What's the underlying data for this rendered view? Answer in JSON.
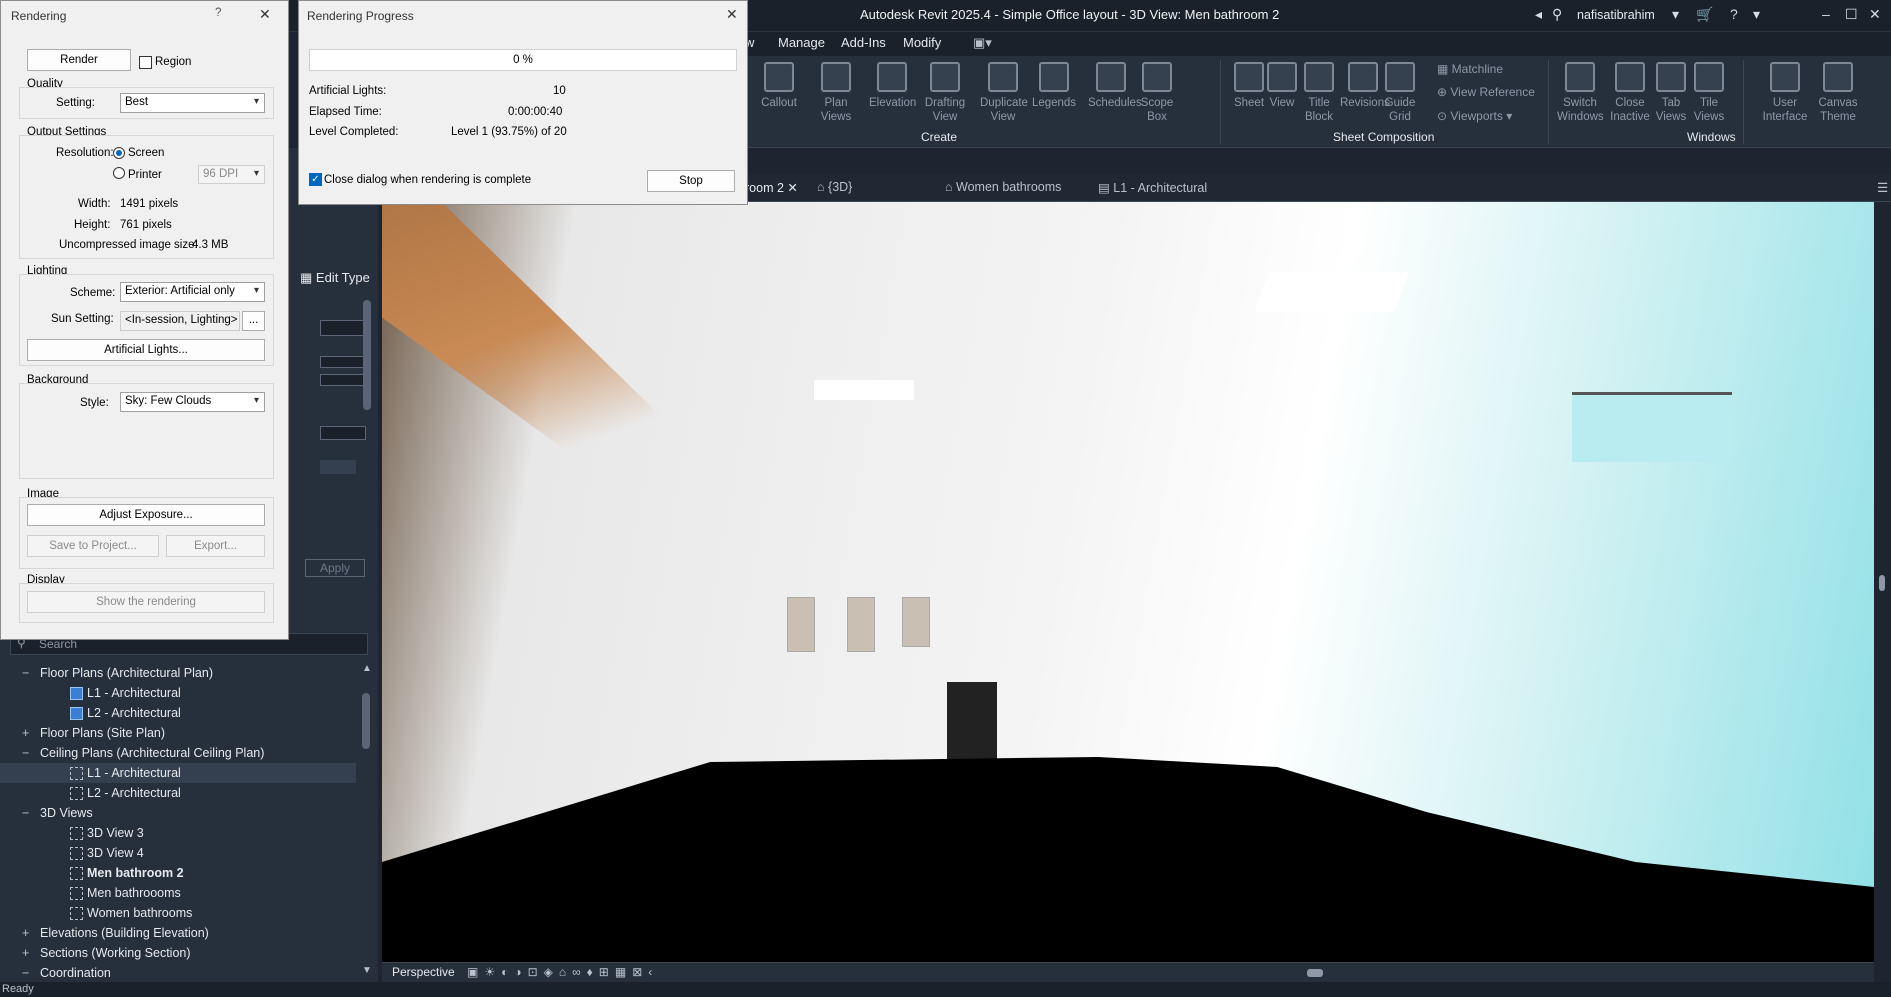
{
  "app": {
    "title": "Autodesk Revit 2025.4 - Simple Office layout - 3D View: Men bathroom 2",
    "user": "nafisatibrahim"
  },
  "ribbon": {
    "tabs": [
      "w",
      "Manage",
      "Add-Ins",
      "Modify"
    ],
    "buttons": [
      {
        "label": "Callout",
        "icon": "callout-icon"
      },
      {
        "label": "Plan Views",
        "icon": "plan-views-icon"
      },
      {
        "label": "Elevation",
        "icon": "elevation-icon"
      },
      {
        "label": "Drafting View",
        "icon": "drafting-view-icon"
      },
      {
        "label": "Duplicate View",
        "icon": "duplicate-view-icon"
      },
      {
        "label": "Legends",
        "icon": "legends-icon"
      },
      {
        "label": "Schedules",
        "icon": "schedules-icon"
      },
      {
        "label": "Scope Box",
        "icon": "scope-box-icon"
      },
      {
        "label": "Sheet",
        "icon": "sheet-icon"
      },
      {
        "label": "View",
        "icon": "view-icon"
      },
      {
        "label": "Title Block",
        "icon": "title-block-icon"
      },
      {
        "label": "Revisions",
        "icon": "revisions-icon"
      },
      {
        "label": "Guide Grid",
        "icon": "guide-grid-icon"
      },
      {
        "label": "Switch Windows",
        "icon": "switch-windows-icon"
      },
      {
        "label": "Close Inactive",
        "icon": "close-inactive-icon"
      },
      {
        "label": "Tab Views",
        "icon": "tab-views-icon"
      },
      {
        "label": "Tile Views",
        "icon": "tile-views-icon"
      },
      {
        "label": "User Interface",
        "icon": "user-interface-icon"
      },
      {
        "label": "Canvas Theme",
        "icon": "canvas-theme-icon"
      }
    ],
    "small": {
      "matchline": "Matchline",
      "view_reference": "View  Reference",
      "viewports": "Viewports"
    },
    "groups": {
      "create": "Create",
      "sheet_composition": "Sheet Composition",
      "windows": "Windows"
    }
  },
  "view_tabs": [
    "room 2",
    "{3D}",
    "Women bathrooms",
    "L1 - Architectural"
  ],
  "properties": {
    "edit_type": "Edit Type",
    "apply": "Apply"
  },
  "browser": {
    "search_placeholder": "Search",
    "items": [
      {
        "label": "Floor Plans (Architectural Plan)",
        "level": 0,
        "pm": "−"
      },
      {
        "label": "L1 - Architectural",
        "level": 1,
        "icon": "floor-plan-icon"
      },
      {
        "label": "L2 - Architectural",
        "level": 1,
        "icon": "floor-plan-icon"
      },
      {
        "label": "Floor Plans (Site Plan)",
        "level": 0,
        "pm": "+"
      },
      {
        "label": "Ceiling Plans (Architectural Ceiling Plan)",
        "level": 0,
        "pm": "−"
      },
      {
        "label": "L1 - Architectural",
        "level": 1,
        "icon": "ceiling-plan-icon",
        "selected": true
      },
      {
        "label": "L2 - Architectural",
        "level": 1,
        "icon": "ceiling-plan-icon"
      },
      {
        "label": "3D Views",
        "level": 0,
        "pm": "−"
      },
      {
        "label": "3D View 3",
        "level": 1,
        "icon": "3d-view-icon"
      },
      {
        "label": "3D View 4",
        "level": 1,
        "icon": "3d-view-icon"
      },
      {
        "label": "Men bathroom 2",
        "level": 1,
        "icon": "3d-view-icon",
        "bold": true
      },
      {
        "label": "Men bathroooms",
        "level": 1,
        "icon": "3d-view-icon"
      },
      {
        "label": "Women bathrooms",
        "level": 1,
        "icon": "3d-view-icon"
      },
      {
        "label": "Elevations (Building Elevation)",
        "level": 0,
        "pm": "+"
      },
      {
        "label": "Sections (Working Section)",
        "level": 0,
        "pm": "+"
      },
      {
        "label": "Coordination",
        "level": 0,
        "pm": "−"
      }
    ]
  },
  "view_control": {
    "mode": "Perspective"
  },
  "status": {
    "left": "Ready"
  },
  "rendering_dialog": {
    "title": "Rendering",
    "render_button": "Render",
    "region_label": "Region",
    "quality": {
      "section": "Quality",
      "setting_label": "Setting:",
      "setting_value": "Best"
    },
    "output": {
      "section": "Output Settings",
      "resolution_label": "Resolution:",
      "screen": "Screen",
      "printer": "Printer",
      "dpi": "96 DPI",
      "width_label": "Width:",
      "width_value": "1491 pixels",
      "height_label": "Height:",
      "height_value": "761 pixels",
      "size_label": "Uncompressed image size:",
      "size_value": "4.3 MB"
    },
    "lighting": {
      "section": "Lighting",
      "scheme_label": "Scheme:",
      "scheme_value": "Exterior: Artificial only",
      "sun_label": "Sun Setting:",
      "sun_value": "<In-session, Lighting>",
      "sun_more": "...",
      "artificial_button": "Artificial Lights..."
    },
    "background": {
      "section": "Background",
      "style_label": "Style:",
      "style_value": "Sky: Few Clouds"
    },
    "image": {
      "section": "Image",
      "adjust": "Adjust Exposure...",
      "save": "Save to Project...",
      "export": "Export..."
    },
    "display": {
      "section": "Display",
      "show": "Show the rendering"
    }
  },
  "progress_dialog": {
    "title": "Rendering Progress",
    "percent": "0 %",
    "lights_label": "Artificial Lights:",
    "lights_value": "10",
    "elapsed_label": "Elapsed Time:",
    "elapsed_value": "0:00:00:40",
    "level_label": "Level Completed:",
    "level_value": "Level 1 (93.75%) of 20",
    "close_label": "Close dialog when rendering is complete",
    "stop": "Stop"
  }
}
